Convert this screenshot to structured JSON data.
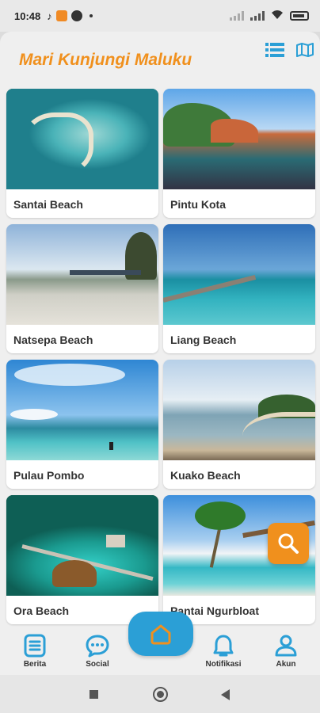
{
  "status_bar": {
    "time": "10:48",
    "app_icons": [
      "tiktok-icon",
      "notification-app-icon",
      "app-icon"
    ]
  },
  "header": {
    "title": "Mari Kunjungi Maluku",
    "list_view_icon": "list-icon",
    "map_view_icon": "map-icon",
    "accent_color": "#f0901d",
    "icon_color": "#2b9fd6"
  },
  "destinations": [
    {
      "name": "Santai Beach"
    },
    {
      "name": "Pintu Kota"
    },
    {
      "name": "Natsepa Beach"
    },
    {
      "name": "Liang Beach"
    },
    {
      "name": "Pulau Pombo"
    },
    {
      "name": "Kuako Beach"
    },
    {
      "name": "Ora Beach"
    },
    {
      "name": "Pantai Ngurbloat"
    }
  ],
  "floating_action": {
    "icon": "search-icon",
    "color": "#f0901d"
  },
  "bottom_nav": {
    "items": [
      {
        "label": "Berita",
        "icon": "news-icon"
      },
      {
        "label": "Social",
        "icon": "chat-icon"
      },
      {
        "label": "Notifikasi",
        "icon": "bell-icon"
      },
      {
        "label": "Akun",
        "icon": "user-icon"
      }
    ],
    "home_icon": "home-icon",
    "home_color": "#2b9fd6"
  }
}
